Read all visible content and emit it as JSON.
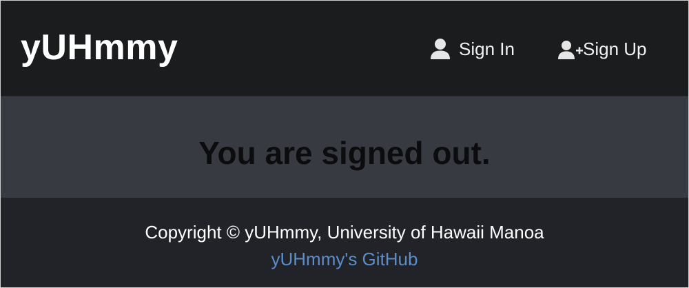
{
  "navbar": {
    "brand": "yUHmmy",
    "items": [
      {
        "label": "Sign In",
        "icon": "user-icon"
      },
      {
        "label": "Sign Up",
        "icon": "user-plus-icon"
      }
    ]
  },
  "main": {
    "status_message": "You are signed out."
  },
  "footer": {
    "copyright": "Copyright © yUHmmy, University of Hawaii Manoa",
    "github_link": "yUHmmy's GitHub"
  },
  "colors": {
    "navbar_bg": "#1b1c1e",
    "main_bg": "#373b41",
    "footer_bg": "#212329",
    "link": "#5b8dc9"
  }
}
